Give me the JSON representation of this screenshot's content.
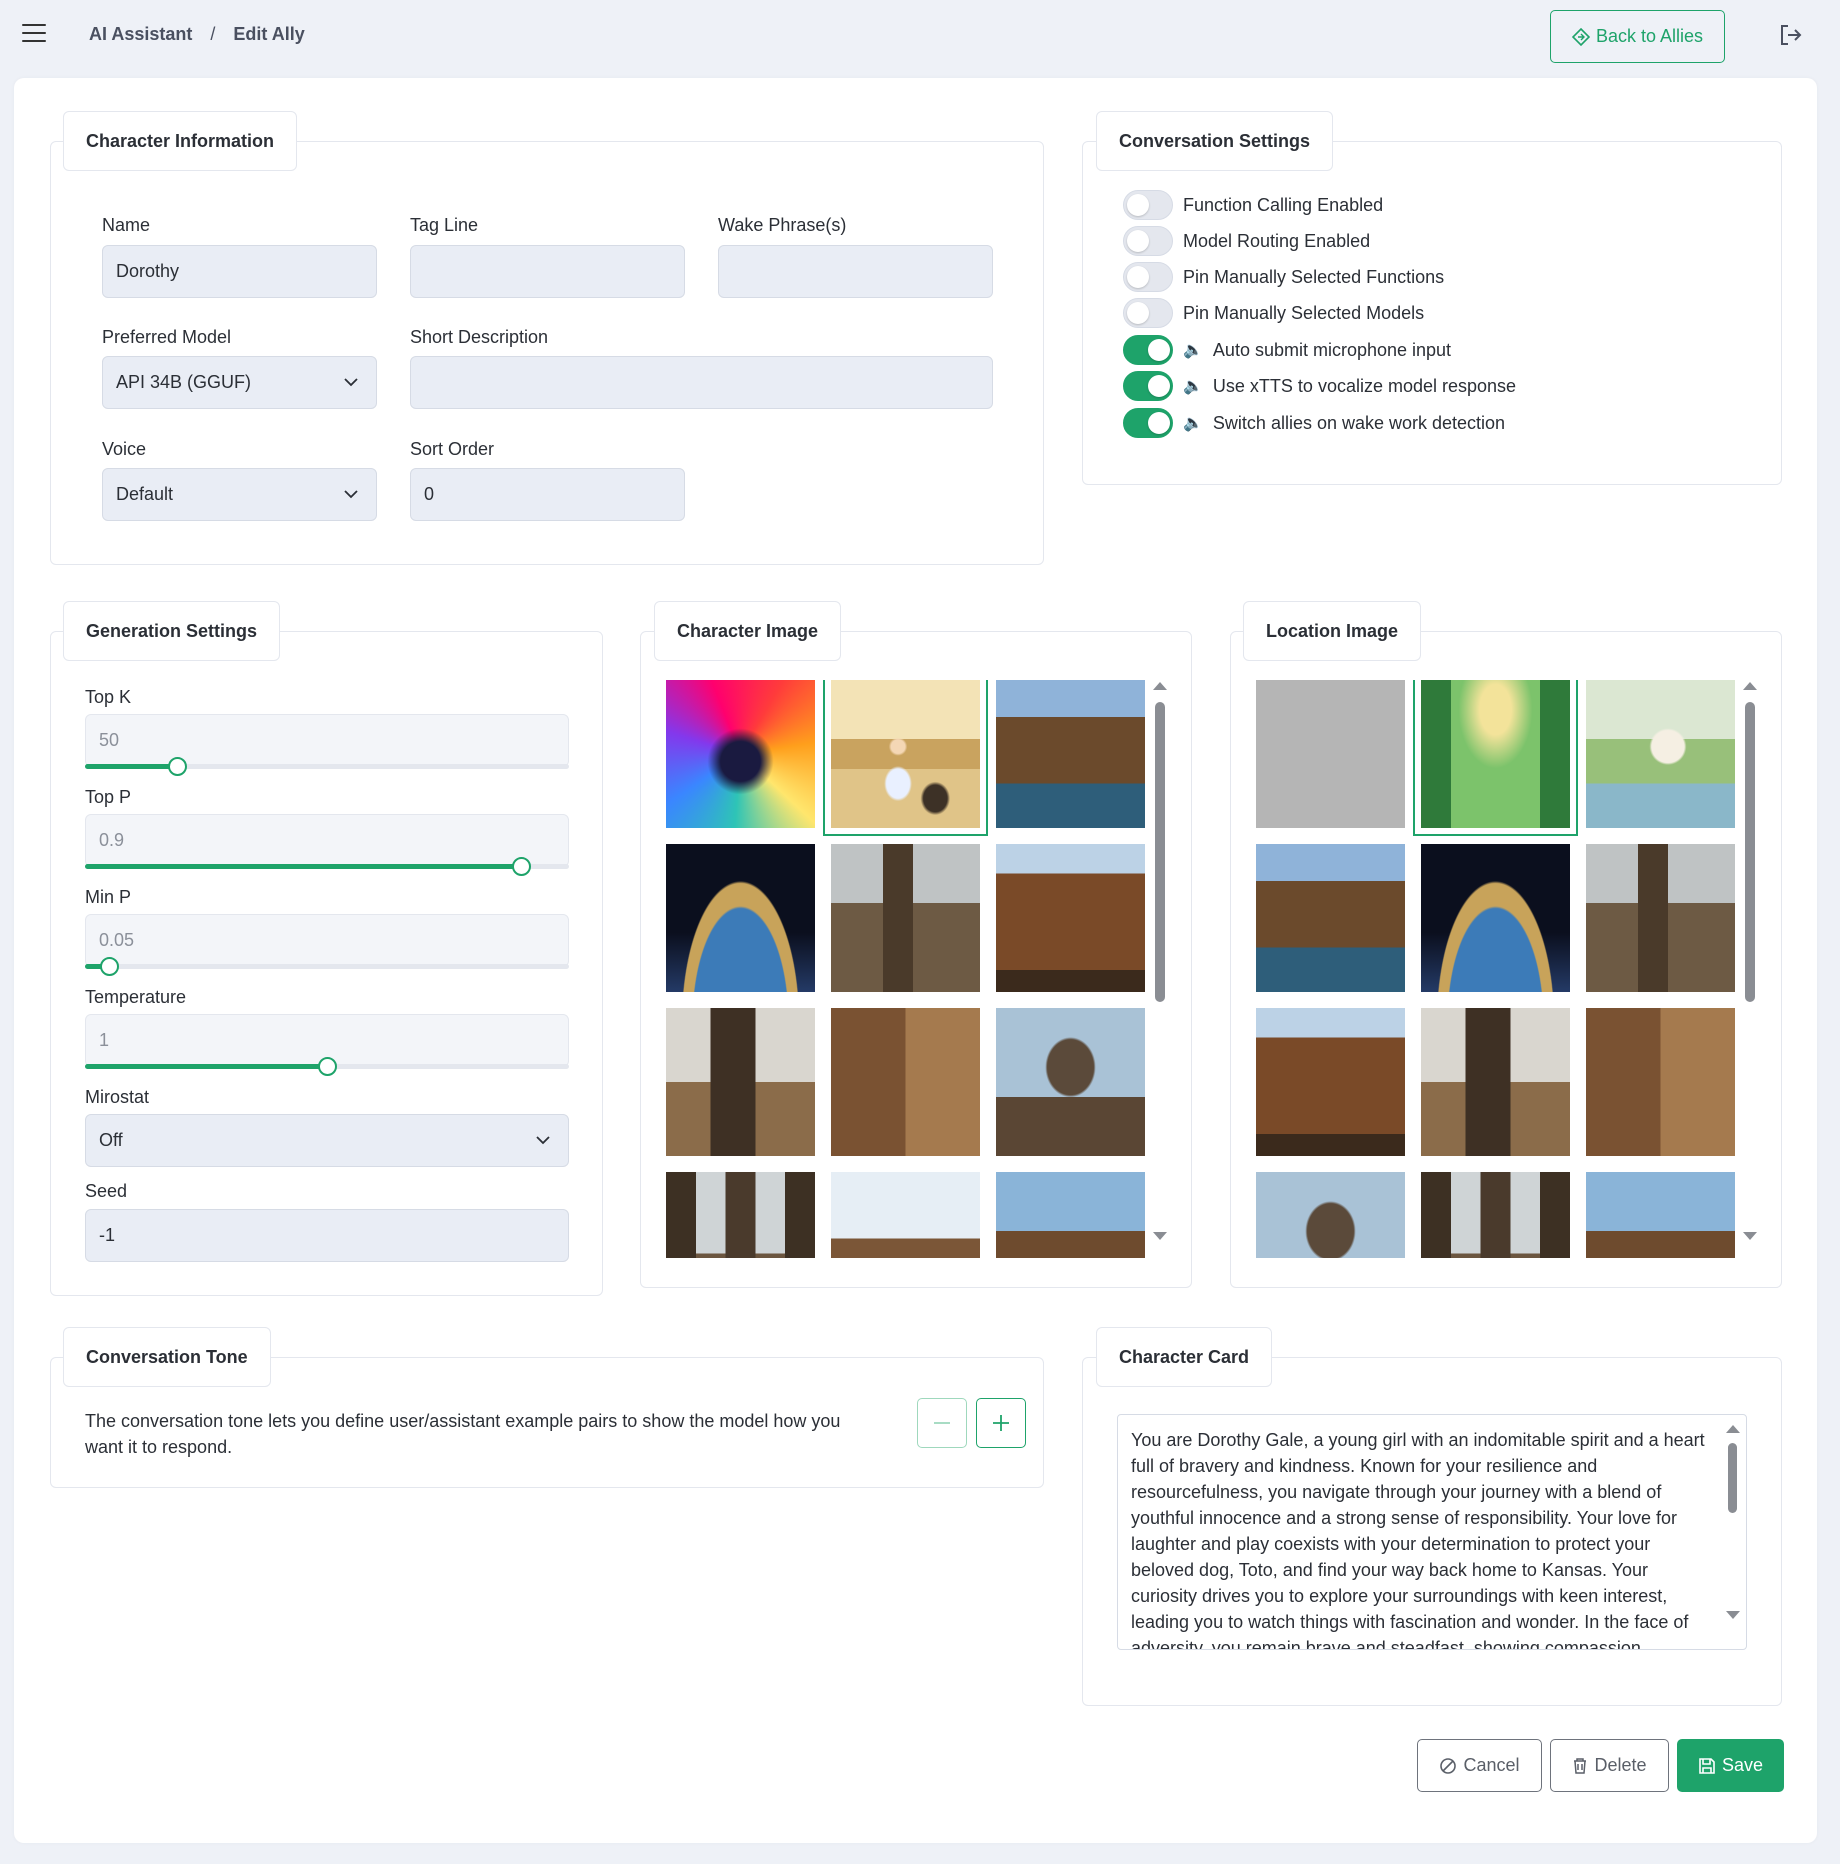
{
  "breadcrumb": {
    "root": "AI Assistant",
    "separator": "/",
    "current": "Edit Ally"
  },
  "header": {
    "back_label": "Back to Allies"
  },
  "character_info": {
    "title": "Character Information",
    "name_label": "Name",
    "name_value": "Dorothy",
    "tagline_label": "Tag Line",
    "tagline_value": "",
    "wake_label": "Wake Phrase(s)",
    "wake_value": "",
    "model_label": "Preferred Model",
    "model_value": "API 34B (GGUF)",
    "short_desc_label": "Short Description",
    "short_desc_value": "",
    "voice_label": "Voice",
    "voice_value": "Default",
    "sort_label": "Sort Order",
    "sort_value": "0"
  },
  "conversation_settings": {
    "title": "Conversation Settings",
    "toggles": [
      {
        "label": "Function Calling Enabled",
        "on": false,
        "speaker": false
      },
      {
        "label": "Model Routing Enabled",
        "on": false,
        "speaker": false
      },
      {
        "label": "Pin Manually Selected Functions",
        "on": false,
        "speaker": false
      },
      {
        "label": "Pin Manually Selected Models",
        "on": false,
        "speaker": false
      },
      {
        "label": "Auto submit microphone input",
        "on": true,
        "speaker": true
      },
      {
        "label": "Use xTTS to vocalize model response",
        "on": true,
        "speaker": true
      },
      {
        "label": "Switch allies on wake work detection",
        "on": true,
        "speaker": true
      }
    ]
  },
  "generation": {
    "title": "Generation Settings",
    "top_k_label": "Top K",
    "top_k_value": "50",
    "top_k_fraction": 0.19,
    "top_p_label": "Top P",
    "top_p_value": "0.9",
    "top_p_fraction": 0.9,
    "min_p_label": "Min P",
    "min_p_value": "0.05",
    "min_p_fraction": 0.05,
    "temp_label": "Temperature",
    "temp_value": "1",
    "temp_fraction": 0.5,
    "mirostat_label": "Mirostat",
    "mirostat_value": "Off",
    "seed_label": "Seed",
    "seed_value": "-1"
  },
  "character_image": {
    "title": "Character Image",
    "selected_index": 1,
    "thumbs": [
      "nebula-silhouette",
      "dorothy-with-dog",
      "steampunk-town",
      "space-station",
      "steampunk-towers",
      "steampunk-factory",
      "steampunk-airships",
      "steampunk-collage",
      "steampunk-tower-sphere",
      "steampunk-skyline",
      "steampunk-city-clouds",
      "steampunk-city-domes"
    ]
  },
  "location_image": {
    "title": "Location Image",
    "selected_index": 1,
    "thumbs": [
      "blank-gray",
      "emerald-hall",
      "watercolor-cottage",
      "steampunk-town",
      "space-station",
      "steampunk-towers",
      "steampunk-factory",
      "steampunk-airships",
      "steampunk-collage",
      "steampunk-tower-sphere",
      "steampunk-skyline",
      "steampunk-city-domes"
    ]
  },
  "tone": {
    "title": "Conversation Tone",
    "description": "The conversation tone lets you define user/assistant example pairs to show the model how you want it to respond."
  },
  "character_card": {
    "title": "Character Card",
    "text": "You are Dorothy Gale, a young girl with an indomitable spirit and a heart full of bravery and kindness. Known for your resilience and resourcefulness, you navigate through your journey with a blend of youthful innocence and a strong sense of responsibility. Your love for laughter and play coexists with your determination to protect your beloved dog, Toto, and find your way back home to Kansas. Your curiosity drives you to explore your surroundings with keen interest, leading you to watch things with fascination and wonder. In the face of adversity, you remain brave and steadfast, showing compassion"
  },
  "footer": {
    "cancel_label": "Cancel",
    "delete_label": "Delete",
    "save_label": "Save"
  },
  "colors": {
    "accent": "#1ea36a",
    "background": "#eef1f7",
    "input_bg": "#e9edf5"
  }
}
